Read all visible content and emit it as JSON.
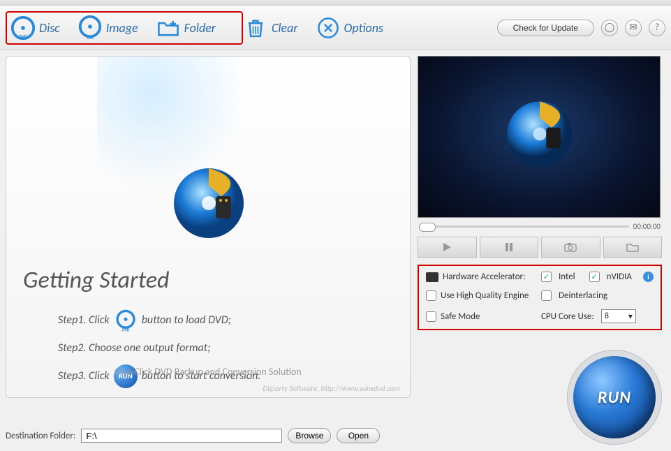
{
  "toolbar": {
    "disc": "Disc",
    "image": "Image",
    "folder": "Folder",
    "clear": "Clear",
    "options": "Options",
    "update": "Check for Update"
  },
  "left": {
    "title": "Getting Started",
    "step1a": "Step1. Click",
    "step1b": "button to load DVD;",
    "step2": "Step2. Choose one output format;",
    "step3a": "Step3. Click",
    "step3b": "button to start conversion.",
    "run_mini": "RUN",
    "slogan": "One-Click DVD Backup and Conversion Solution",
    "credit": "Digiarty Software, http://www.winxdvd.com"
  },
  "preview": {
    "time": "00:00:00"
  },
  "settings": {
    "hw_label": "Hardware Accelerator:",
    "intel": "Intel",
    "nvidia": "nVIDIA",
    "intel_checked": true,
    "nvidia_checked": true,
    "hq": "Use High Quality Engine",
    "deint": "Deinterlacing",
    "safe": "Safe Mode",
    "cpu_label": "CPU Core Use:",
    "cpu_value": "8"
  },
  "run_label": "RUN",
  "footer": {
    "dest_label": "Destination Folder:",
    "dest_value": "F:\\",
    "browse": "Browse",
    "open": "Open"
  }
}
